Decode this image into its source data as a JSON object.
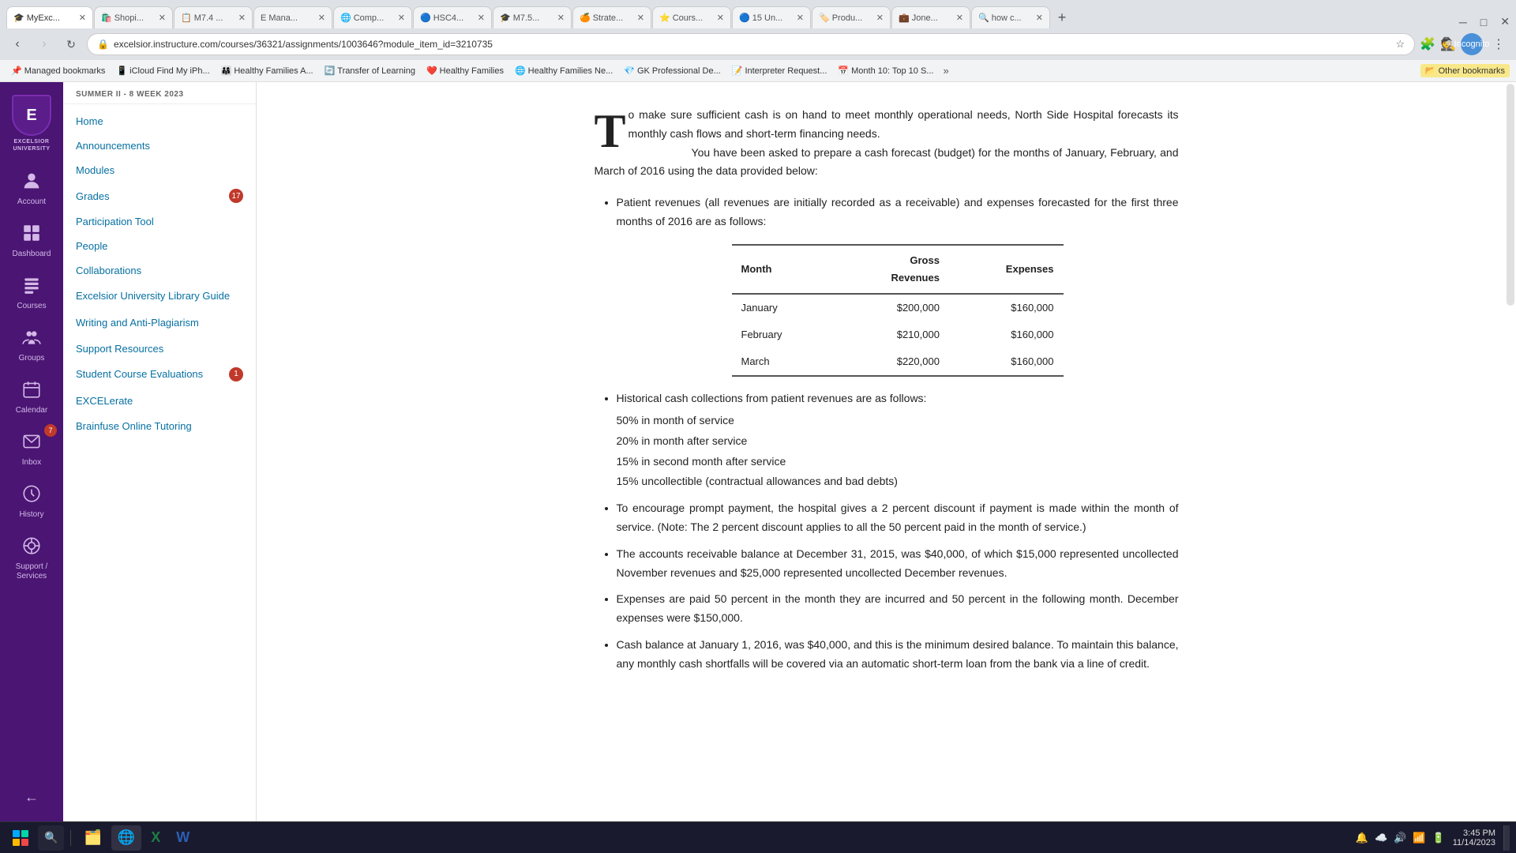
{
  "browser": {
    "tabs": [
      {
        "id": "t1",
        "favicon": "🎓",
        "label": "MyExc...",
        "active": true,
        "closable": true
      },
      {
        "id": "t2",
        "favicon": "🛍️",
        "label": "Shopi...",
        "active": false,
        "closable": true
      },
      {
        "id": "t3",
        "favicon": "📋",
        "label": "M7.4 ...",
        "active": false,
        "closable": true
      },
      {
        "id": "t4",
        "favicon": "📊",
        "label": "Mana...",
        "active": false,
        "closable": true
      },
      {
        "id": "t5",
        "favicon": "💻",
        "label": "Comp...",
        "active": false,
        "closable": true
      },
      {
        "id": "t6",
        "favicon": "🏥",
        "label": "HSC4...",
        "active": false,
        "closable": true
      },
      {
        "id": "t7",
        "favicon": "🎓",
        "label": "M7.5...",
        "active": false,
        "closable": true
      },
      {
        "id": "t8",
        "favicon": "📈",
        "label": "Strate...",
        "active": false,
        "closable": true
      },
      {
        "id": "t9",
        "favicon": "⭐",
        "label": "Cours...",
        "active": false,
        "closable": true
      },
      {
        "id": "t10",
        "favicon": "🔵",
        "label": "15 Un...",
        "active": false,
        "closable": true
      },
      {
        "id": "t11",
        "favicon": "🏷️",
        "label": "Produ...",
        "active": false,
        "closable": true
      },
      {
        "id": "t12",
        "favicon": "💼",
        "label": "Jone...",
        "active": false,
        "closable": true
      },
      {
        "id": "t13",
        "favicon": "🔍",
        "label": "how c...",
        "active": false,
        "closable": true
      }
    ],
    "address": "excelsior.instructure.com/courses/36321/assignments/1003646?module_item_id=3210735",
    "profile": "Incognito",
    "bookmarks": [
      {
        "icon": "📌",
        "label": "Managed bookmarks"
      },
      {
        "icon": "📱",
        "label": "iCloud Find My iPh..."
      },
      {
        "icon": "👨‍👩‍👧",
        "label": "Healthy Families A..."
      },
      {
        "icon": "🔄",
        "label": "Transfer of Learning"
      },
      {
        "icon": "❤️",
        "label": "Healthy Families"
      },
      {
        "icon": "🌐",
        "label": "Healthy Families Ne..."
      },
      {
        "icon": "💎",
        "label": "GK Professional De..."
      },
      {
        "icon": "📝",
        "label": "Interpreter Request..."
      },
      {
        "icon": "📅",
        "label": "Month 10: Top 10 S..."
      }
    ],
    "overflow_label": "»",
    "other_bookmarks": "Other bookmarks"
  },
  "nav_rail": {
    "logo_line1": "EXCELSIOR",
    "logo_line2": "UNIVERSITY",
    "items": [
      {
        "id": "account",
        "icon": "👤",
        "label": "Account",
        "badge": null
      },
      {
        "id": "dashboard",
        "icon": "⊞",
        "label": "Dashboard",
        "badge": null
      },
      {
        "id": "courses",
        "icon": "📚",
        "label": "Courses",
        "badge": null
      },
      {
        "id": "groups",
        "icon": "👥",
        "label": "Groups",
        "badge": null
      },
      {
        "id": "calendar",
        "icon": "📅",
        "label": "Calendar",
        "badge": null
      },
      {
        "id": "inbox",
        "icon": "✉️",
        "label": "Inbox",
        "badge": "7"
      },
      {
        "id": "history",
        "icon": "🕐",
        "label": "History",
        "badge": null
      },
      {
        "id": "support",
        "icon": "⚙️",
        "label": "Support / Services",
        "badge": null
      }
    ],
    "collapse_icon": "←"
  },
  "sidebar": {
    "session": "SUMMER II - 8 WEEK 2023",
    "links": [
      {
        "label": "Home",
        "badge": null
      },
      {
        "label": "Announcements",
        "badge": null
      },
      {
        "label": "Modules",
        "badge": null
      },
      {
        "label": "Grades",
        "badge": "17"
      },
      {
        "label": "Participation Tool",
        "badge": null
      },
      {
        "label": "People",
        "badge": null
      },
      {
        "label": "Collaborations",
        "badge": null
      },
      {
        "label": "Excelsior University Library Guide",
        "badge": null
      },
      {
        "label": "Writing and Anti-Plagiarism",
        "badge": null
      },
      {
        "label": "Support Resources",
        "badge": null
      },
      {
        "label": "Student Course Evaluations",
        "badge": "1"
      },
      {
        "label": "EXCELerate",
        "badge": null
      },
      {
        "label": "Brainfuse Online Tutoring",
        "badge": null
      }
    ]
  },
  "content": {
    "intro_text": "o make sure sufficient cash is on hand to meet monthly operational needs, North Side Hospital forecasts its monthly cash flows and short-term financing needs. You have been asked to prepare a cash forecast (budget) for the months of January, February, and March of 2016 using the data provided below:",
    "drop_cap": "T",
    "table": {
      "headers": [
        "Month",
        "Gross\nRevenues",
        "Expenses"
      ],
      "rows": [
        [
          "January",
          "$200,000",
          "$160,000"
        ],
        [
          "February",
          "$210,000",
          "$160,000"
        ],
        [
          "March",
          "$220,000",
          "$160,000"
        ]
      ]
    },
    "bullet_points": [
      {
        "text": "Patient revenues (all revenues are initially recorded as a receivable) and expenses forecasted for the first three months of 2016 are as follows:"
      },
      {
        "text": "Historical cash collections from patient revenues are as follows:",
        "sub_items": [
          "50% in month of service",
          "20% in month after service",
          "15% in second month after service",
          "15% uncollectible (contractual allowances and bad debts)"
        ]
      },
      {
        "text": "To encourage prompt payment, the hospital gives a 2 percent discount if payment is made within the month of service. (Note: The 2 percent discount applies to all the 50 percent paid in the month of service.)"
      },
      {
        "text": "The accounts receivable balance at December 31, 2015, was $40,000, of which $15,000 represented uncollected November revenues and $25,000 represented uncollected December revenues."
      },
      {
        "text": "Expenses are paid 50 percent in the month they are incurred and 50 percent in the following month. December expenses were $150,000."
      },
      {
        "text": "Cash balance at January 1, 2016, was $40,000, and this is the minimum desired balance. To maintain this balance, any monthly cash shortfalls will be covered via an automatic short-term loan from the bank via a line of credit."
      }
    ]
  },
  "taskbar": {
    "apps": [
      {
        "icon": "🗂️",
        "label": ""
      },
      {
        "icon": "🌐",
        "label": ""
      },
      {
        "icon": "📊",
        "label": ""
      },
      {
        "icon": "📝",
        "label": ""
      }
    ],
    "time": "3:45 PM",
    "date": "11/14/2023",
    "sys_icons": [
      "🔔",
      "☁️",
      "🔊",
      "📶"
    ]
  }
}
